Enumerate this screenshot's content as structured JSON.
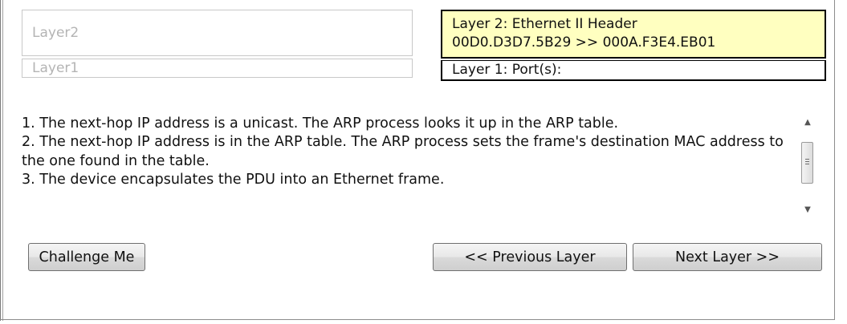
{
  "layers": {
    "layer2_left": "Layer2",
    "layer1_left": "Layer1",
    "layer2_right_line1": "Layer 2: Ethernet II Header",
    "layer2_right_line2": "00D0.D3D7.5B29 >> 000A.F3E4.EB01",
    "layer1_right": "Layer 1: Port(s):"
  },
  "description": {
    "lines": [
      "1. The next-hop IP address is a unicast. The ARP process looks it up in the ARP table.",
      "2. The next-hop IP address is in the ARP table. The ARP process sets the frame's destination MAC address to the one found in the table.",
      "3. The device encapsulates the PDU into an Ethernet frame."
    ]
  },
  "buttons": {
    "challenge": "Challenge Me",
    "previous": "<< Previous Layer",
    "next": "Next Layer >>"
  },
  "colors": {
    "highlight": "#ffffc0",
    "placeholder_text": "#b4b4b4"
  },
  "icons": {
    "scroll_up": "scroll-up-arrow-icon",
    "scroll_down": "scroll-down-arrow-icon"
  }
}
